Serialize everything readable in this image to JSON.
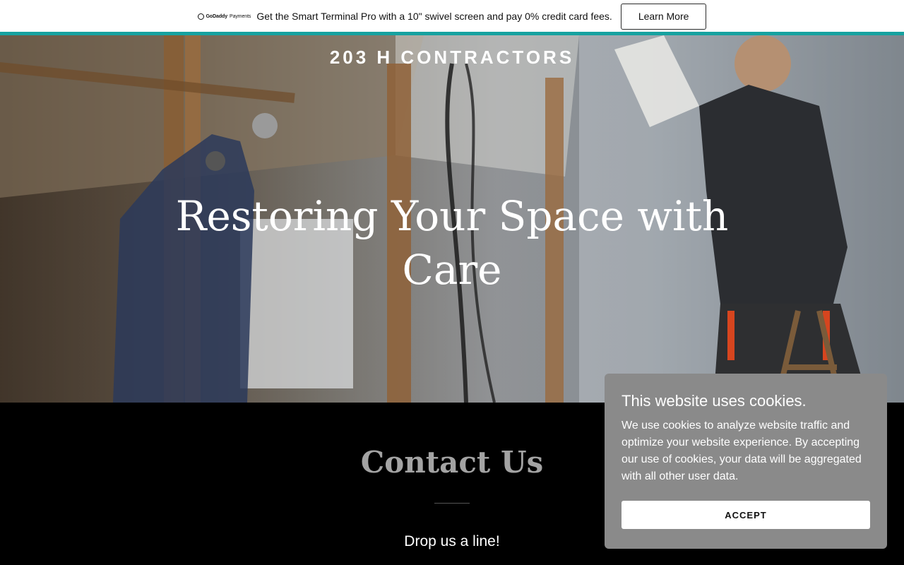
{
  "promo": {
    "logo_brand": "GoDaddy",
    "logo_product": "Payments",
    "text": "Get the Smart Terminal Pro with a 10\" swivel screen and pay 0% credit card fees.",
    "button_label": "Learn More",
    "stripe_color": "#16a2a0"
  },
  "header": {
    "site_title": "203 H CONTRACTORS"
  },
  "hero": {
    "heading": "Restoring Your Space with Care",
    "image_subject": "workers-renovating-interior-photo"
  },
  "contact": {
    "title": "Contact Us",
    "subtitle": "Drop us a line!"
  },
  "cookie_banner": {
    "title": "This website uses cookies.",
    "body": "We use cookies to analyze website traffic and optimize your website experience. By accepting our use of cookies, your data will be aggregated with all other user data.",
    "accept_label": "ACCEPT",
    "background_color": "#8a8a8a"
  }
}
